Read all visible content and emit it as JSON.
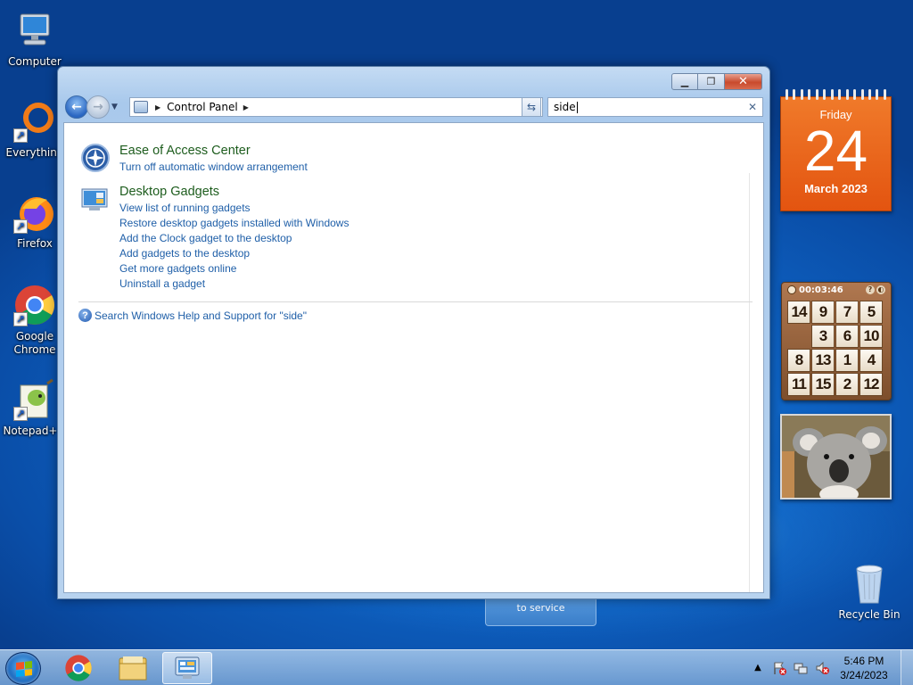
{
  "desktop": {
    "icons": [
      {
        "label": "Computer"
      },
      {
        "label": "Everything"
      },
      {
        "label": "Firefox"
      },
      {
        "label": "Google Chrome"
      },
      {
        "label": "Notepad++"
      }
    ],
    "recycle_bin": {
      "label": "Recycle Bin"
    },
    "background_tile": {
      "text": "to service"
    }
  },
  "window": {
    "address_path": [
      "Control Panel"
    ],
    "search": {
      "value": "side"
    },
    "results": [
      {
        "title": "Ease of Access Center",
        "links": [
          "Turn off automatic window arrangement"
        ]
      },
      {
        "title": "Desktop Gadgets",
        "links": [
          "View list of running gadgets",
          "Restore desktop gadgets installed with Windows",
          "Add the Clock gadget to the desktop",
          "Add gadgets to the desktop",
          "Get more gadgets online",
          "Uninstall a gadget"
        ]
      }
    ],
    "help_link": "Search Windows Help and Support for \"side\""
  },
  "gadgets": {
    "calendar": {
      "weekday": "Friday",
      "day": "24",
      "month_year": "March 2023"
    },
    "puzzle": {
      "timer": "00:03:46",
      "tiles": [
        "14",
        "9",
        "7",
        "5",
        "",
        "3",
        "6",
        "10",
        "8",
        "13",
        "1",
        "4",
        "11",
        "15",
        "2",
        "12"
      ]
    }
  },
  "taskbar": {
    "clock": {
      "time": "5:46 PM",
      "date": "3/24/2023"
    }
  },
  "colors": {
    "result_title": "#1e5d1e",
    "link": "#1f5fa8",
    "calendar_orange": "#e85a15"
  }
}
